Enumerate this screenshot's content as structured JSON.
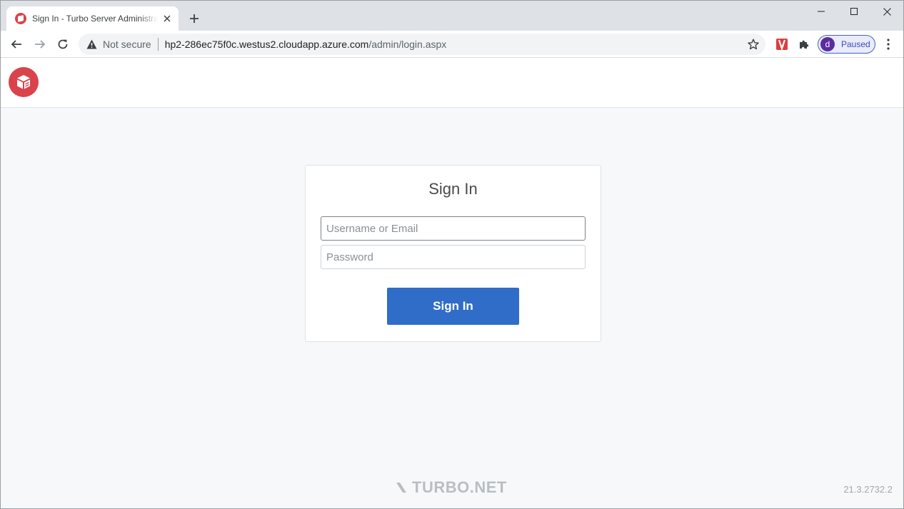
{
  "browser": {
    "tab": {
      "title": "Sign In - Turbo Server Administration",
      "close_icon": "close-icon",
      "favicon": "turbo-favicon-icon"
    },
    "new_tab_icon": "plus-icon",
    "window_controls": [
      "minimize-icon",
      "maximize-icon",
      "close-icon"
    ],
    "address_bar": {
      "security_label": "Not secure",
      "host": "hp2-286ec75f0c.westus2.cloudapp.azure.com",
      "path": "/admin/login.aspx"
    },
    "profile": {
      "initial": "d",
      "status": "Paused",
      "avatar_color": "#5b2c9f"
    }
  },
  "page": {
    "logo_icon": "turbo-cube-logo-icon",
    "brand_color": "#d9434b",
    "signin": {
      "title": "Sign In",
      "username_placeholder": "Username or Email",
      "username_value": "",
      "password_placeholder": "Password",
      "password_value": "",
      "button_label": "Sign In",
      "button_color": "#2f6dc8"
    },
    "footer": {
      "brand": "TURBO.NET",
      "version": "21.3.2732.2"
    }
  }
}
